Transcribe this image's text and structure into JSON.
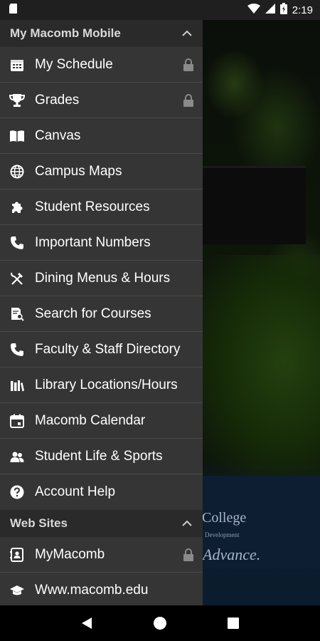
{
  "status_bar": {
    "time": "2:19"
  },
  "drawer": {
    "sections": [
      {
        "title": "My Macomb Mobile",
        "items": [
          {
            "label": "My Schedule",
            "icon": "calendar-grid-icon",
            "locked": true
          },
          {
            "label": "Grades",
            "icon": "trophy-icon",
            "locked": true
          },
          {
            "label": "Canvas",
            "icon": "book-icon",
            "locked": false
          },
          {
            "label": "Campus Maps",
            "icon": "globe-icon",
            "locked": false
          },
          {
            "label": "Student Resources",
            "icon": "puzzle-icon",
            "locked": false
          },
          {
            "label": "Important Numbers",
            "icon": "phone-icon",
            "locked": false
          },
          {
            "label": "Dining Menus & Hours",
            "icon": "fork-knife-icon",
            "locked": false
          },
          {
            "label": "Search for Courses",
            "icon": "document-search-icon",
            "locked": false
          },
          {
            "label": "Faculty & Staff Directory",
            "icon": "phone-icon",
            "locked": false
          },
          {
            "label": "Library Locations/Hours",
            "icon": "library-books-icon",
            "locked": false
          },
          {
            "label": "Macomb Calendar",
            "icon": "calendar-icon",
            "locked": false
          },
          {
            "label": "Student Life & Sports",
            "icon": "people-icon",
            "locked": false
          },
          {
            "label": "Account Help",
            "icon": "help-circle-icon",
            "locked": false
          }
        ]
      },
      {
        "title": "Web Sites",
        "items": [
          {
            "label": "MyMacomb",
            "icon": "portal-icon",
            "locked": true
          },
          {
            "label": "Www.macomb.edu",
            "icon": "graduation-cap-icon",
            "locked": false
          }
        ]
      }
    ]
  },
  "background": {
    "college_text": "College",
    "dev_text": "Development",
    "advance_text": "Advance."
  },
  "colors": {
    "drawer_bg": "#353535",
    "section_header_bg": "#2a2a2a",
    "divider": "#4a4a4a",
    "status_bar_bg": "#1f1f1f"
  }
}
